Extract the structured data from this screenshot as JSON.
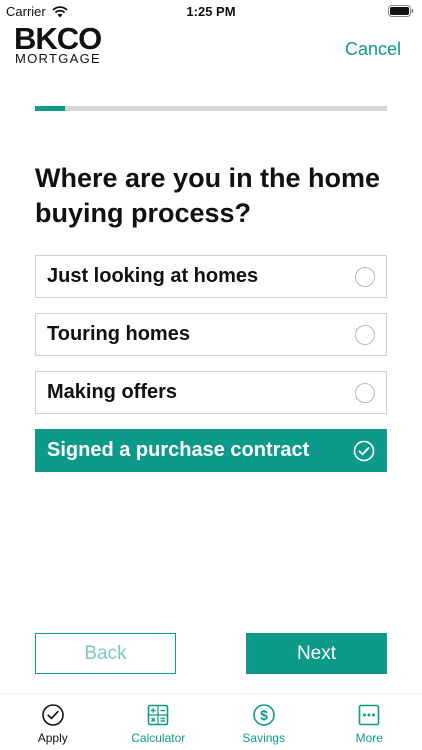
{
  "status_bar": {
    "carrier": "Carrier",
    "time": "1:25 PM"
  },
  "header": {
    "logo_main": "BKCO",
    "logo_sub": "MORTGAGE",
    "cancel_label": "Cancel"
  },
  "progress": {
    "fraction": 0.085
  },
  "question": "Where are you in the home buying process?",
  "options": [
    {
      "label": "Just looking at homes",
      "selected": false
    },
    {
      "label": "Touring homes",
      "selected": false
    },
    {
      "label": "Making offers",
      "selected": false
    },
    {
      "label": "Signed a purchase contract",
      "selected": true
    }
  ],
  "buttons": {
    "back_label": "Back",
    "next_label": "Next"
  },
  "tab_bar": {
    "tabs": [
      {
        "label": "Apply",
        "icon": "check-circle-icon",
        "active": true
      },
      {
        "label": "Calculator",
        "icon": "calculator-icon",
        "active": false
      },
      {
        "label": "Savings",
        "icon": "dollar-circle-icon",
        "active": false
      },
      {
        "label": "More",
        "icon": "more-icon",
        "active": false
      }
    ]
  },
  "colors": {
    "accent": "#0e9a8a",
    "accent_light": "#7fc8bf",
    "border": "#cfcfcf"
  }
}
